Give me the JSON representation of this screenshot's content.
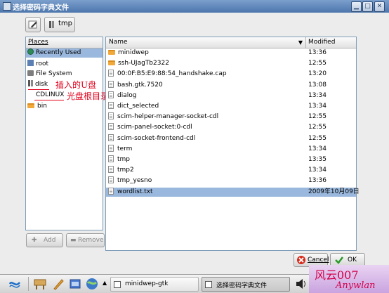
{
  "window": {
    "title": "选择密码字典文件"
  },
  "toolbar": {
    "current_dir": "tmp"
  },
  "places": {
    "header": "Places",
    "items": [
      {
        "label": "Recently Used",
        "icon": "recently-used-icon"
      },
      {
        "label": "root",
        "icon": "home-icon"
      },
      {
        "label": "File System",
        "icon": "hard-drive-icon"
      },
      {
        "label": "disk",
        "icon": "drive-icon"
      },
      {
        "label": "CDLINUX",
        "icon": "cdrom-icon"
      },
      {
        "label": "bin",
        "icon": "folder-icon"
      }
    ],
    "add_label": "Add",
    "remove_label": "Remove"
  },
  "annotations": {
    "usb": "插入的U盘",
    "cdroot": "光盘根目录"
  },
  "files": {
    "col_name": "Name",
    "col_modified": "Modified",
    "rows": [
      {
        "name": "minidwep",
        "modified": "13:36",
        "type": "folder"
      },
      {
        "name": "ssh-UJagTb2322",
        "modified": "12:55",
        "type": "folder"
      },
      {
        "name": "00:0F:B5:E9:88:54_handshake.cap",
        "modified": "13:20",
        "type": "file"
      },
      {
        "name": "bash.gtk.7520",
        "modified": "13:08",
        "type": "file"
      },
      {
        "name": "dialog",
        "modified": "13:34",
        "type": "file"
      },
      {
        "name": "dict_selected",
        "modified": "13:34",
        "type": "file"
      },
      {
        "name": "scim-helper-manager-socket-cdl",
        "modified": "12:55",
        "type": "file"
      },
      {
        "name": "scim-panel-socket:0-cdl",
        "modified": "12:55",
        "type": "file"
      },
      {
        "name": "scim-socket-frontend-cdl",
        "modified": "12:55",
        "type": "file"
      },
      {
        "name": "term",
        "modified": "13:34",
        "type": "file"
      },
      {
        "name": "tmp",
        "modified": "13:35",
        "type": "file"
      },
      {
        "name": "tmp2",
        "modified": "13:34",
        "type": "file"
      },
      {
        "name": "tmp_yesno",
        "modified": "13:36",
        "type": "file"
      },
      {
        "name": "wordlist.txt",
        "modified": "2009年10月09日",
        "type": "file",
        "selected": true
      }
    ]
  },
  "buttons": {
    "cancel": "Cancel",
    "ok": "OK"
  },
  "taskbar": {
    "task1": "minidwep-gtk",
    "task2": "选择密码字典文件",
    "watermark_1": "风云007",
    "watermark_2": "Anywlan"
  },
  "colors": {
    "selection": "#9ab8dd",
    "folder": "#f2a93b",
    "annotation": "#e0001b",
    "titlebar": "#4d76ad"
  }
}
